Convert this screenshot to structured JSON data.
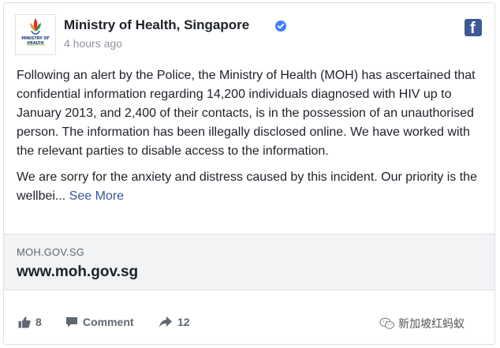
{
  "post": {
    "page_name": "Ministry of Health, Singapore",
    "timestamp": "4 hours ago",
    "avatar_logo_text": "MINISTRY OF HEALTH",
    "avatar_logo_sub": "SINGAPORE",
    "verified_icon": "verified-badge-icon",
    "network_icon": "facebook-icon",
    "paragraph_1": "Following an alert by the Police, the Ministry of Health (MOH) has ascertained that confidential information regarding 14,200 individuals diagnosed with HIV up to January 2013, and 2,400 of their contacts, is in the possession of an unauthorised person. The information has been illegally disclosed online. We have worked with the relevant parties to disable access to the information.",
    "paragraph_2": "We are sorry for the anxiety and distress caused by this incident. Our priority is the wellbei...",
    "see_more": "See More"
  },
  "link": {
    "domain": "MOH.GOV.SG",
    "title": "www.moh.gov.sg"
  },
  "actions": {
    "likes": "8",
    "comment_label": "Comment",
    "shares": "12"
  },
  "watermark": {
    "text": "新加坡红蚂蚁"
  },
  "colors": {
    "link_blue": "#385898",
    "facebook_blue": "#3b5998",
    "verified_blue": "#4080ff",
    "muted_text": "#90949c"
  }
}
